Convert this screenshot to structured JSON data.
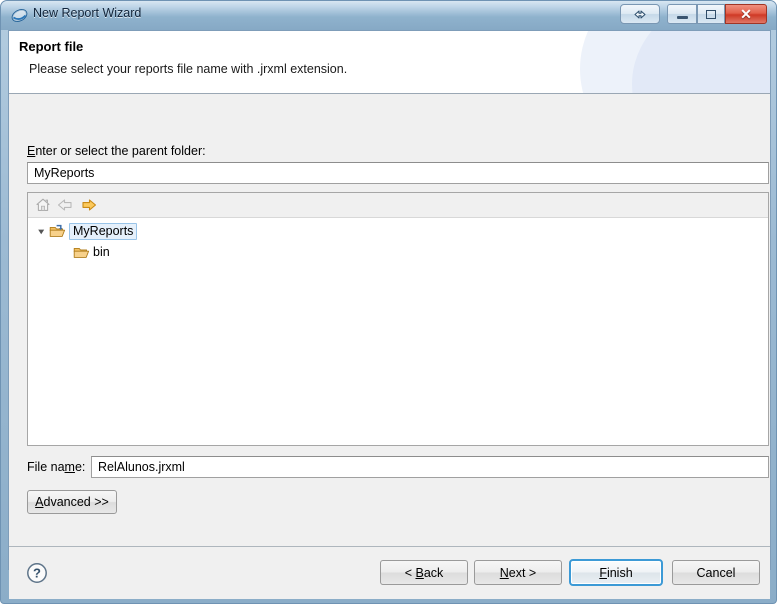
{
  "window": {
    "title": "New Report Wizard",
    "icon": "jasper-report-icon",
    "controls": {
      "restore_size": "restore-size-icon",
      "minimize": "minimize-icon",
      "maximize": "maximize-icon",
      "close": "close-icon"
    }
  },
  "header": {
    "title": "Report file",
    "description": "Please select your reports file name with .jrxml extension."
  },
  "form": {
    "parent_folder_label_pre": "E",
    "parent_folder_label_post": "nter or select the parent folder:",
    "parent_folder_value": "MyReports",
    "parent_folder_placeholder": "",
    "file_name_label_pre": "File na",
    "file_name_label_mnem": "m",
    "file_name_label_post": "e:",
    "file_name_value": "RelAlunos.jrxml",
    "file_name_placeholder": "",
    "advanced_label_pre": "A",
    "advanced_label_post": "dvanced >>"
  },
  "tree": {
    "toolbar": {
      "home": "home-icon",
      "back": "back-arrow-icon",
      "forward": "forward-arrow-icon"
    },
    "nodes": [
      {
        "label": "MyReports",
        "icon": "project-folder-icon",
        "selected": true,
        "expanded": true,
        "level": 0
      },
      {
        "label": "bin",
        "icon": "folder-icon",
        "selected": false,
        "expanded": false,
        "level": 1
      }
    ]
  },
  "buttons": {
    "help": "help-icon",
    "back_pre": "< ",
    "back_mnem": "B",
    "back_post": "ack",
    "next_pre": "",
    "next_mnem": "N",
    "next_post": "ext >",
    "finish_mnem": "F",
    "finish_post": "inish",
    "cancel": "Cancel"
  },
  "colors": {
    "title_bar": "#8badc8",
    "default_button_focus": "#3c9ad6",
    "close_button": "#cf3a26",
    "selection": "#e5f0fb",
    "folder_gold": "#e8a33d",
    "forward_arrow": "#f2b33c"
  }
}
